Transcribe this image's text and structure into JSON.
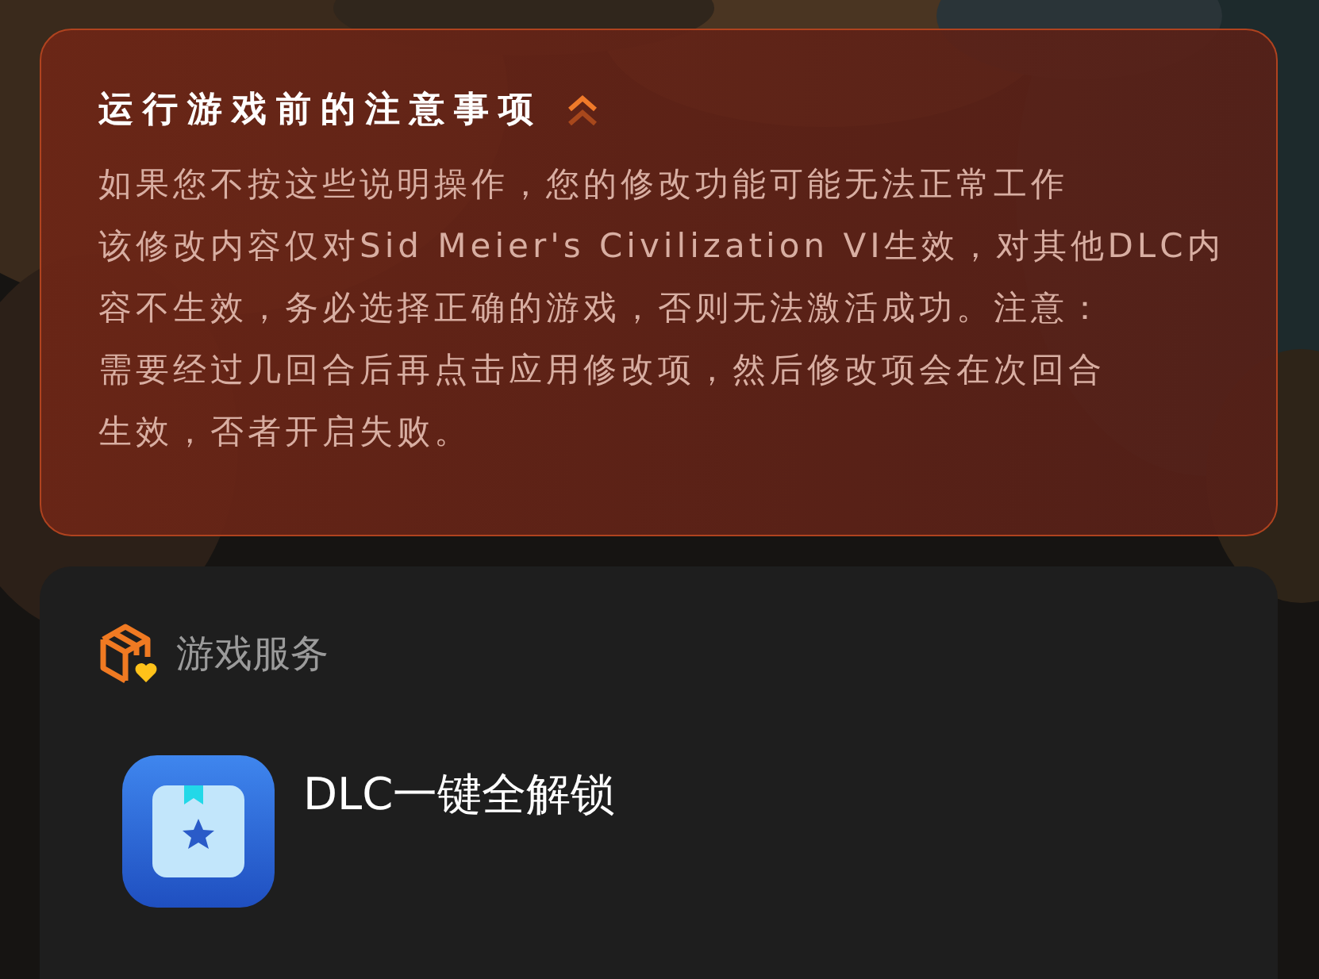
{
  "notice": {
    "title": "运行游戏前的注意事项",
    "expanded": true,
    "paragraphs": [
      {
        "lines": [
          "如果您不按这些说明操作，您的修改功能可能无法正常工作"
        ]
      },
      {
        "lines": [
          "该修改内容仅对Sid Meier's Civilization VI生效，对其他DLC内",
          "容不生效，务必选择正确的游戏，否则无法激活成功。注意：",
          "需要经过几回合后再点击应用修改项，然后修改项会在次回合",
          "生效，否者开启失败。"
        ]
      }
    ]
  },
  "service": {
    "title": "游戏服务",
    "items": [
      {
        "label": "DLC一键全解锁"
      }
    ]
  }
}
